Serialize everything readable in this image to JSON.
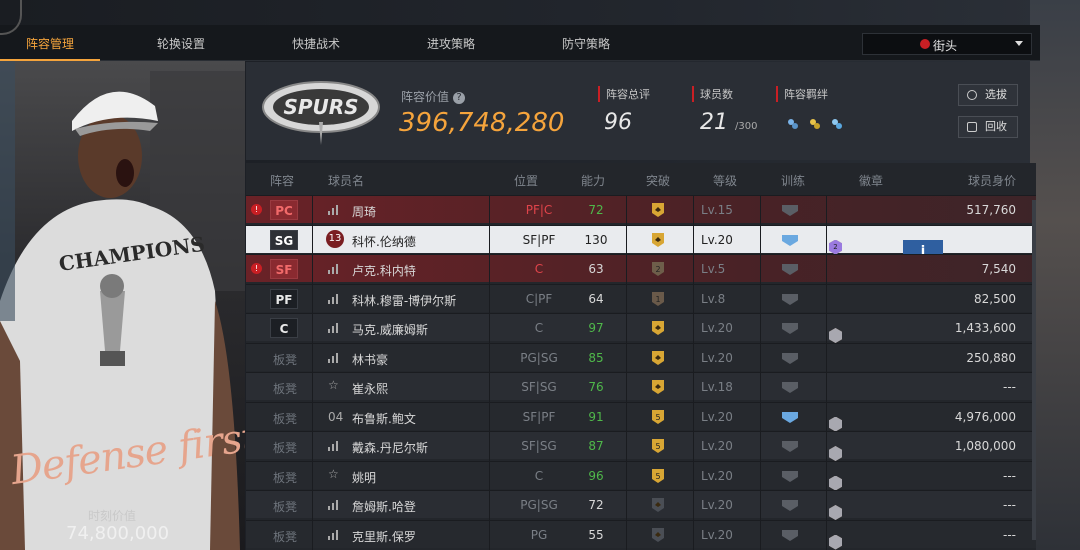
{
  "tabs": [
    {
      "label": "阵容管理",
      "active": true
    },
    {
      "label": "轮换设置",
      "active": false
    },
    {
      "label": "快捷战术",
      "active": false
    },
    {
      "label": "进攻策略",
      "active": false
    },
    {
      "label": "防守策略",
      "active": false
    }
  ],
  "mode_select": {
    "value": "街头"
  },
  "left_panel": {
    "slogan": "Defense first",
    "value_label": "时刻价值",
    "value": "74,800,000",
    "shirt_text": "CHAMPIONS"
  },
  "header": {
    "team_logo_text": "SPURS",
    "team_value_label": "阵容价值",
    "team_value": "396,748,280",
    "rating_label": "阵容总评",
    "rating": "96",
    "count_label": "球员数",
    "count": "21",
    "count_max": "/300",
    "chem_label": "阵容羁绊",
    "btn_select": "选拔",
    "btn_recycle": "回收"
  },
  "table": {
    "headers": {
      "lineup": "阵容",
      "name": "球员名",
      "pos": "位置",
      "ability": "能力",
      "breakthrough": "突破",
      "level": "等级",
      "training": "训练",
      "badges": "徽章",
      "value": "球员身价"
    },
    "rows": [
      {
        "slot": "PC",
        "name": "周琦",
        "pos": "PF|C",
        "ability": "72",
        "breakthrough": "",
        "level": "Lv.15",
        "value": "517,760",
        "style": "red",
        "warn": true,
        "abil_color": "green",
        "pos_color": "red"
      },
      {
        "slot": "SG",
        "name": "科怀.伦纳德",
        "pos": "SF|PF",
        "ability": "130",
        "breakthrough": "",
        "level": "Lv.20",
        "value": "",
        "style": "sel",
        "warn": false,
        "abil_color": "",
        "pos_color": "",
        "jersey": "13"
      },
      {
        "slot": "SF",
        "name": "卢克.科内特",
        "pos": "C",
        "ability": "63",
        "breakthrough": "2",
        "level": "Lv.5",
        "value": "7,540",
        "style": "red",
        "warn": true,
        "abil_color": "",
        "pos_color": "red"
      },
      {
        "slot": "PF",
        "name": "科林.穆雷-博伊尔斯",
        "pos": "C|PF",
        "ability": "64",
        "breakthrough": "1",
        "level": "Lv.8",
        "value": "82,500",
        "style": "alt",
        "warn": false,
        "abil_color": "",
        "pos_color": "dim"
      },
      {
        "slot": "C",
        "name": "马克.威廉姆斯",
        "pos": "C",
        "ability": "97",
        "breakthrough": "",
        "level": "Lv.20",
        "value": "1,433,600",
        "style": "",
        "warn": false,
        "abil_color": "green",
        "pos_color": "dim"
      },
      {
        "slot": "板凳",
        "name": "林书豪",
        "pos": "PG|SG",
        "ability": "85",
        "breakthrough": "",
        "level": "Lv.20",
        "value": "250,880",
        "style": "alt",
        "warn": false,
        "abil_color": "green",
        "pos_color": "dim",
        "bench": true
      },
      {
        "slot": "板凳",
        "name": "崔永熙",
        "pos": "SF|SG",
        "ability": "76",
        "breakthrough": "",
        "level": "Lv.18",
        "value": "---",
        "style": "",
        "warn": false,
        "abil_color": "green",
        "pos_color": "dim",
        "bench": true,
        "star": true
      },
      {
        "slot": "板凳",
        "name": "布鲁斯.鲍文",
        "pos": "SF|PF",
        "ability": "91",
        "breakthrough": "5",
        "level": "Lv.20",
        "value": "4,976,000",
        "style": "alt",
        "warn": false,
        "abil_color": "green",
        "pos_color": "dim",
        "bench": true,
        "num": "04"
      },
      {
        "slot": "板凳",
        "name": "戴森.丹尼尔斯",
        "pos": "SF|SG",
        "ability": "87",
        "breakthrough": "5",
        "level": "Lv.20",
        "value": "1,080,000",
        "style": "",
        "warn": false,
        "abil_color": "green",
        "pos_color": "dim",
        "bench": true
      },
      {
        "slot": "板凳",
        "name": "姚明",
        "pos": "C",
        "ability": "96",
        "breakthrough": "5",
        "level": "Lv.20",
        "value": "---",
        "style": "alt",
        "warn": false,
        "abil_color": "green",
        "pos_color": "dim",
        "bench": true,
        "star": true
      },
      {
        "slot": "板凳",
        "name": "詹姆斯.哈登",
        "pos": "PG|SG",
        "ability": "72",
        "breakthrough": "",
        "level": "Lv.20",
        "value": "---",
        "style": "",
        "warn": false,
        "abil_color": "",
        "pos_color": "dim",
        "bench": true
      },
      {
        "slot": "板凳",
        "name": "克里斯.保罗",
        "pos": "PG",
        "ability": "55",
        "breakthrough": "",
        "level": "Lv.20",
        "value": "---",
        "style": "alt",
        "warn": false,
        "abil_color": "",
        "pos_color": "dim",
        "bench": true
      }
    ]
  },
  "selected_badges": [
    "12",
    "25",
    "6",
    "2"
  ],
  "colors": {
    "accent": "#f5a43c",
    "danger": "#c91f24",
    "action": "#2f5fa0"
  }
}
